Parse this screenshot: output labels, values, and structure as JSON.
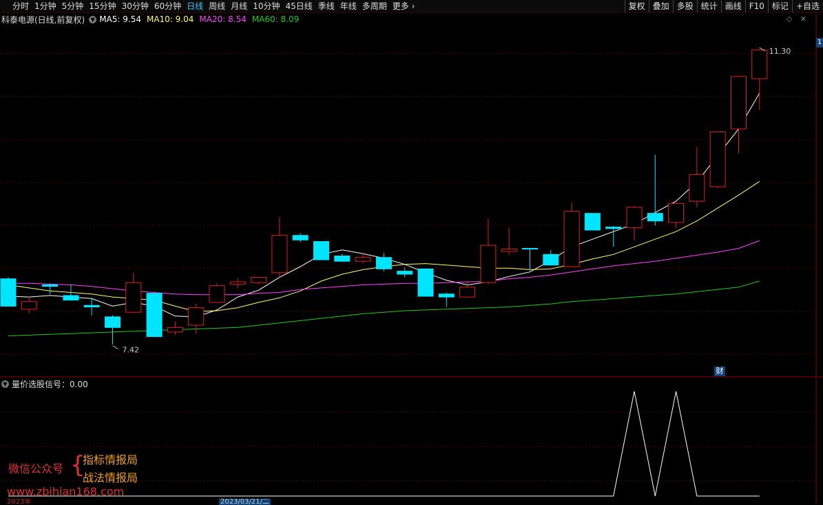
{
  "toolbar": {
    "tabs": [
      "分时",
      "1分钟",
      "5分钟",
      "15分钟",
      "30分钟",
      "60分钟",
      "日线",
      "周线",
      "月线",
      "10分钟",
      "45日线",
      "季线",
      "年线",
      "多周期",
      "更多"
    ],
    "active_tab": "日线",
    "right_buttons": [
      "复权",
      "叠加",
      "多股",
      "统计",
      "画线",
      "F10",
      "标记",
      "+自选"
    ]
  },
  "legend": {
    "stock": "科泰电源(日线,前复权)",
    "ma5": "MA5: 9.54",
    "ma10": "MA10: 9.04",
    "ma20": "MA20: 8.54",
    "ma60": "MA60: 8.09"
  },
  "indicator": {
    "label": "量价选股信号：0.00"
  },
  "badges": {
    "page": "1",
    "cai": "财"
  },
  "watermark": {
    "wechat": "微信公众号",
    "line1": "指标情报局",
    "line2": "战法情报局",
    "url": "www.zbihian168.com"
  },
  "bottom": {
    "year": "2023年",
    "date": "2023/03/21/二"
  },
  "colors": {
    "up": "#e02020",
    "down": "#00e5ff",
    "ma5": "#ffffff",
    "ma10": "#ffff66",
    "ma20": "#ff44ff",
    "ma60": "#22cc22",
    "grid": "#5a0000"
  },
  "chart_data": {
    "type": "candlestick",
    "ylim": [
      7.0,
      11.6
    ],
    "high_label": "11.30",
    "low_label": "7.42",
    "candles": [
      {
        "o": 8.28,
        "h": 8.3,
        "l": 7.92,
        "c": 7.92
      },
      {
        "o": 7.88,
        "h": 8.05,
        "l": 7.83,
        "c": 7.98
      },
      {
        "o": 8.2,
        "h": 8.22,
        "l": 8.08,
        "c": 8.18
      },
      {
        "o": 8.06,
        "h": 8.2,
        "l": 7.99,
        "c": 8.0
      },
      {
        "o": 7.93,
        "h": 8.03,
        "l": 7.8,
        "c": 7.91
      },
      {
        "o": 7.78,
        "h": 7.8,
        "l": 7.42,
        "c": 7.64
      },
      {
        "o": 7.84,
        "h": 8.36,
        "l": 7.83,
        "c": 8.23
      },
      {
        "o": 8.09,
        "h": 8.09,
        "l": 7.52,
        "c": 7.52
      },
      {
        "o": 7.58,
        "h": 7.72,
        "l": 7.54,
        "c": 7.64
      },
      {
        "o": 7.67,
        "h": 7.95,
        "l": 7.56,
        "c": 7.9
      },
      {
        "o": 7.97,
        "h": 8.22,
        "l": 7.97,
        "c": 8.19
      },
      {
        "o": 8.21,
        "h": 8.29,
        "l": 8.16,
        "c": 8.24
      },
      {
        "o": 8.23,
        "h": 8.3,
        "l": 8.21,
        "c": 8.3
      },
      {
        "o": 8.36,
        "h": 9.09,
        "l": 8.3,
        "c": 8.85
      },
      {
        "o": 8.85,
        "h": 8.88,
        "l": 8.76,
        "c": 8.79
      },
      {
        "o": 8.77,
        "h": 8.77,
        "l": 8.53,
        "c": 8.53
      },
      {
        "o": 8.58,
        "h": 8.61,
        "l": 8.5,
        "c": 8.51
      },
      {
        "o": 8.51,
        "h": 8.62,
        "l": 8.48,
        "c": 8.56
      },
      {
        "o": 8.56,
        "h": 8.62,
        "l": 8.38,
        "c": 8.41
      },
      {
        "o": 8.38,
        "h": 8.43,
        "l": 8.3,
        "c": 8.34
      },
      {
        "o": 8.41,
        "h": 8.41,
        "l": 8.05,
        "c": 8.05
      },
      {
        "o": 8.08,
        "h": 8.1,
        "l": 7.91,
        "c": 8.04
      },
      {
        "o": 8.04,
        "h": 8.23,
        "l": 8.04,
        "c": 8.17
      },
      {
        "o": 8.23,
        "h": 9.07,
        "l": 8.21,
        "c": 8.72
      },
      {
        "o": 8.64,
        "h": 8.95,
        "l": 8.6,
        "c": 8.67
      },
      {
        "o": 8.68,
        "h": 8.68,
        "l": 8.39,
        "c": 8.67
      },
      {
        "o": 8.6,
        "h": 8.66,
        "l": 8.46,
        "c": 8.46
      },
      {
        "o": 8.44,
        "h": 9.28,
        "l": 8.44,
        "c": 9.17
      },
      {
        "o": 9.14,
        "h": 9.14,
        "l": 8.92,
        "c": 8.92
      },
      {
        "o": 8.96,
        "h": 8.97,
        "l": 8.7,
        "c": 8.94
      },
      {
        "o": 8.95,
        "h": 9.24,
        "l": 8.78,
        "c": 9.22
      },
      {
        "o": 9.14,
        "h": 9.91,
        "l": 8.98,
        "c": 9.04
      },
      {
        "o": 9.02,
        "h": 9.3,
        "l": 8.95,
        "c": 9.27
      },
      {
        "o": 9.3,
        "h": 10.01,
        "l": 9.22,
        "c": 9.65
      },
      {
        "o": 9.49,
        "h": 10.21,
        "l": 9.47,
        "c": 10.21
      },
      {
        "o": 10.25,
        "h": 10.71,
        "l": 9.93,
        "c": 10.94
      },
      {
        "o": 10.91,
        "h": 11.3,
        "l": 10.5,
        "c": 11.29
      }
    ],
    "series": [
      {
        "name": "MA5",
        "values": [
          8.05,
          8.04,
          8.06,
          8.04,
          8.02,
          7.92,
          7.97,
          7.92,
          7.79,
          7.78,
          7.87,
          8.04,
          8.13,
          8.3,
          8.44,
          8.6,
          8.66,
          8.61,
          8.55,
          8.47,
          8.36,
          8.26,
          8.2,
          8.24,
          8.31,
          8.37,
          8.52,
          8.7,
          8.8,
          8.9,
          9.0,
          9.15,
          9.3,
          9.55,
          9.9,
          10.25,
          10.72
        ]
      },
      {
        "name": "MA10",
        "values": [
          8.2,
          8.16,
          8.12,
          8.1,
          8.08,
          8.04,
          8.02,
          8.0,
          7.92,
          7.85,
          7.86,
          7.9,
          7.97,
          8.03,
          8.12,
          8.25,
          8.34,
          8.4,
          8.44,
          8.47,
          8.48,
          8.46,
          8.44,
          8.42,
          8.42,
          8.4,
          8.41,
          8.47,
          8.54,
          8.6,
          8.7,
          8.8,
          8.9,
          9.04,
          9.21,
          9.38,
          9.56
        ]
      },
      {
        "name": "MA20",
        "values": [
          8.22,
          8.22,
          8.21,
          8.2,
          8.18,
          8.15,
          8.12,
          8.1,
          8.08,
          8.07,
          8.07,
          8.07,
          8.09,
          8.1,
          8.14,
          8.16,
          8.18,
          8.2,
          8.21,
          8.22,
          8.22,
          8.23,
          8.24,
          8.25,
          8.28,
          8.3,
          8.33,
          8.37,
          8.41,
          8.45,
          8.48,
          8.51,
          8.55,
          8.59,
          8.63,
          8.68,
          8.78
        ]
      },
      {
        "name": "MA60",
        "values": [
          7.53,
          7.54,
          7.55,
          7.56,
          7.57,
          7.58,
          7.59,
          7.6,
          7.61,
          7.62,
          7.63,
          7.64,
          7.67,
          7.7,
          7.73,
          7.76,
          7.79,
          7.82,
          7.84,
          7.86,
          7.87,
          7.88,
          7.89,
          7.9,
          7.91,
          7.93,
          7.95,
          7.98,
          8.0,
          8.02,
          8.04,
          8.06,
          8.08,
          8.11,
          8.14,
          8.17,
          8.25
        ]
      }
    ],
    "indicator": {
      "name": "量价选股信号",
      "ylim": [
        0,
        1
      ],
      "values": [
        0,
        0,
        0,
        0,
        0,
        0,
        0,
        0,
        0,
        0,
        0,
        0,
        0,
        0,
        0,
        0,
        0,
        0,
        0,
        0,
        0,
        0,
        0,
        0,
        0,
        0,
        0,
        0,
        0,
        0,
        1,
        0,
        1,
        0,
        0,
        0,
        0
      ]
    }
  }
}
